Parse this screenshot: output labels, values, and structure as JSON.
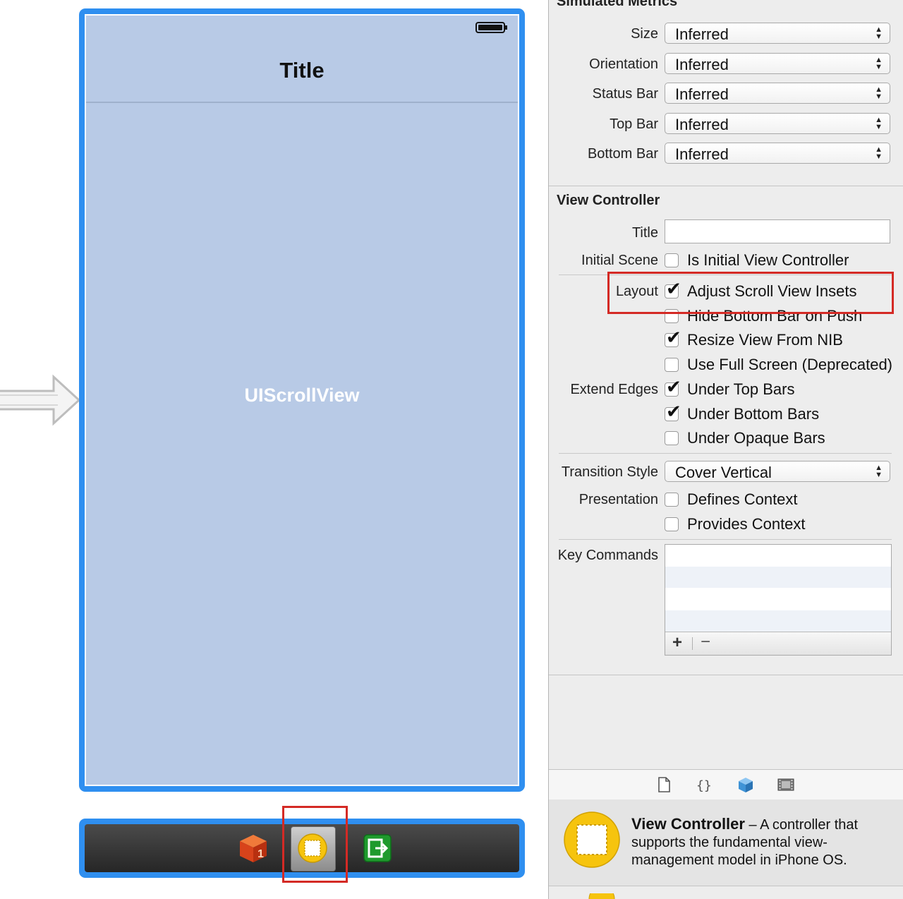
{
  "canvas": {
    "navbar_title": "Title",
    "scroll_view_label": "UIScrollView",
    "dock_icons": [
      "first-responder-cube-icon",
      "view-controller-icon",
      "exit-icon"
    ]
  },
  "inspector": {
    "simulated_metrics": {
      "header": "Simulated Metrics",
      "rows": [
        {
          "label": "Size",
          "value": "Inferred"
        },
        {
          "label": "Orientation",
          "value": "Inferred"
        },
        {
          "label": "Status Bar",
          "value": "Inferred"
        },
        {
          "label": "Top Bar",
          "value": "Inferred"
        },
        {
          "label": "Bottom Bar",
          "value": "Inferred"
        }
      ]
    },
    "view_controller": {
      "header": "View Controller",
      "title_label": "Title",
      "title_value": "",
      "initial_scene_label": "Initial Scene",
      "layout_label": "Layout",
      "extend_edges_label": "Extend Edges",
      "transition_style_label": "Transition Style",
      "transition_style_value": "Cover Vertical",
      "presentation_label": "Presentation",
      "key_commands_label": "Key Commands",
      "checkboxes": [
        {
          "label": "Is Initial View Controller",
          "checked": false
        },
        {
          "label": "Adjust Scroll View Insets",
          "checked": true
        },
        {
          "label": "Hide Bottom Bar on Push",
          "checked": false
        },
        {
          "label": "Resize View From NIB",
          "checked": true
        },
        {
          "label": "Use Full Screen (Deprecated)",
          "checked": false
        },
        {
          "label": "Under Top Bars",
          "checked": true
        },
        {
          "label": "Under Bottom Bars",
          "checked": true
        },
        {
          "label": "Under Opaque Bars",
          "checked": false
        },
        {
          "label": "Defines Context",
          "checked": false
        },
        {
          "label": "Provides Context",
          "checked": false
        }
      ],
      "key_commands_add": "+",
      "key_commands_remove": "−"
    },
    "library_tabs": [
      "file-template-icon",
      "code-snippet-icon",
      "object-cube-icon",
      "media-film-icon"
    ],
    "library_entry": {
      "name": "View Controller",
      "description": " – A controller that supports the fundamental view-management model in iPhone OS."
    }
  },
  "colors": {
    "selection_blue": "#2f8ff0",
    "highlight_red": "#d42a25",
    "scene_background": "#b8cae6"
  }
}
